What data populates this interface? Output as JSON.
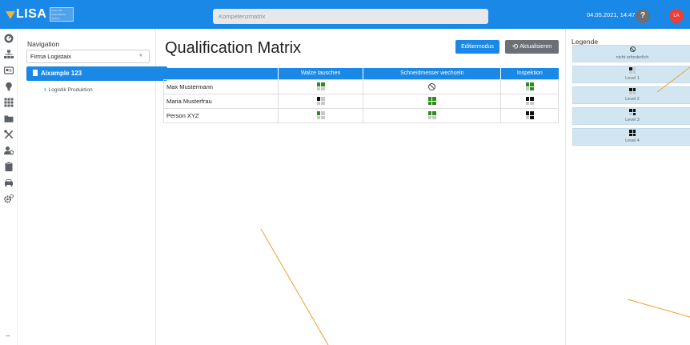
{
  "app": {
    "logo_text": "LISA",
    "logo_subtext": "Lern- und Informations- System",
    "search_placeholder": "Kompetenzmatrix",
    "datetime": "04.05.2021, 14:47",
    "help_label": "?",
    "user_initials": "LA",
    "expand_label": "↔"
  },
  "colors": {
    "primary": "#1a88e6",
    "secondary_button": "#6b7076",
    "avatar": "#e8413c",
    "legend_bg": "#d2e6f1",
    "level_black": "#111111",
    "level_green": "#2e8b1e",
    "level_grey": "#c8c8c8",
    "annotation_line": "#f0a030"
  },
  "rail_icons": [
    "dashboard-icon",
    "org-chart-icon",
    "id-card-icon",
    "lightbulb-icon",
    "grid-icon",
    "folder-icon",
    "tools-icon",
    "user-settings-icon",
    "clipboard-icon",
    "car-icon",
    "settings-icon"
  ],
  "navigation": {
    "title": "Navigation",
    "company": "Firma  Logistaix",
    "selected_item": "Aixample 123",
    "child_item": "Logistik Produktion"
  },
  "main": {
    "title": "Qualification Matrix",
    "edit_button": "Editiermodus",
    "refresh_button": "Aktualisieren",
    "columns": [
      "",
      "Walze tauschen",
      "Schneidmesser wechseln",
      "Inspektion"
    ],
    "rows": [
      {
        "name": "Max Mustermann",
        "cells": [
          {
            "type": "level",
            "level": 2,
            "color": "green"
          },
          {
            "type": "not_required"
          },
          {
            "type": "level",
            "level": 3,
            "color": "green"
          }
        ]
      },
      {
        "name": "Maria Musterfrau",
        "cells": [
          {
            "type": "level",
            "level": 1,
            "color": "black"
          },
          {
            "type": "level",
            "level": 4,
            "color": "green"
          },
          {
            "type": "level",
            "level": 2,
            "color": "black"
          }
        ]
      },
      {
        "name": "Person XYZ",
        "cells": [
          {
            "type": "level",
            "level": 1,
            "color": "green"
          },
          {
            "type": "level",
            "level": 2,
            "color": "green"
          },
          {
            "type": "level",
            "level": 3,
            "color": "black"
          }
        ]
      }
    ]
  },
  "legend": {
    "title": "Legende",
    "items": [
      {
        "label": "nicht erforderlich",
        "type": "not_required"
      },
      {
        "label": "Level 1",
        "type": "level",
        "level": 1
      },
      {
        "label": "Level 2",
        "type": "level",
        "level": 2
      },
      {
        "label": "Level 3",
        "type": "level",
        "level": 3
      },
      {
        "label": "Level 4",
        "type": "level",
        "level": 4
      }
    ]
  }
}
